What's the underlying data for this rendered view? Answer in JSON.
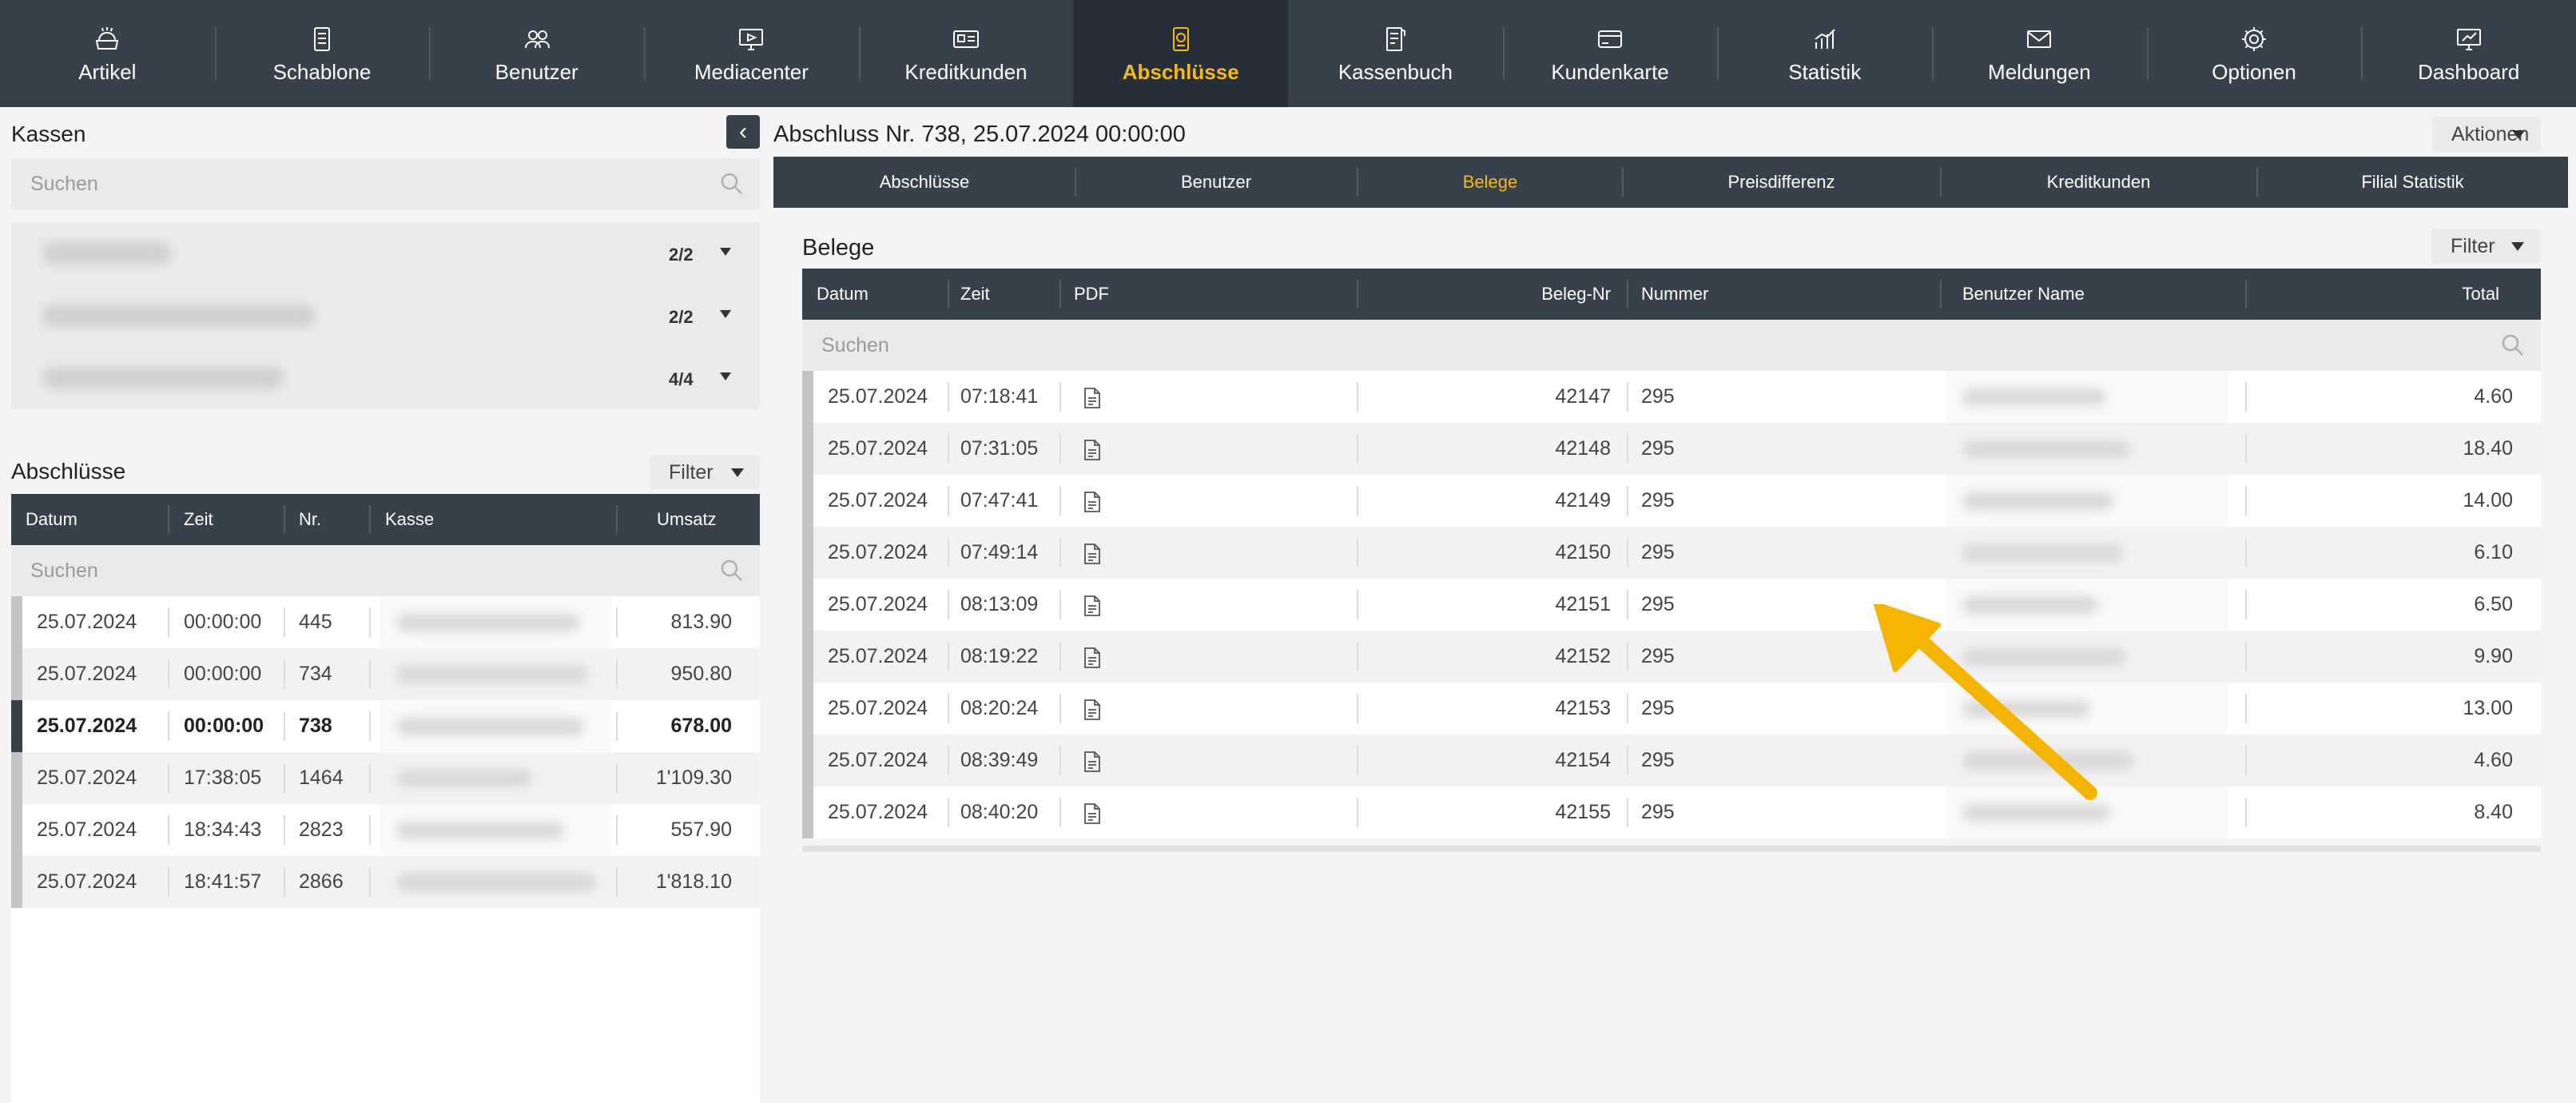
{
  "nav": [
    {
      "label": "Artikel",
      "icon": "basket-icon"
    },
    {
      "label": "Schablone",
      "icon": "template-icon"
    },
    {
      "label": "Benutzer",
      "icon": "users-icon"
    },
    {
      "label": "Mediacenter",
      "icon": "monitor-icon"
    },
    {
      "label": "Kreditkunden",
      "icon": "id-card-icon"
    },
    {
      "label": "Abschlüsse",
      "icon": "closing-icon",
      "active": true
    },
    {
      "label": "Kassenbuch",
      "icon": "ledger-icon"
    },
    {
      "label": "Kundenkarte",
      "icon": "card-icon"
    },
    {
      "label": "Statistik",
      "icon": "chart-icon"
    },
    {
      "label": "Meldungen",
      "icon": "mail-icon"
    },
    {
      "label": "Optionen",
      "icon": "gear-icon"
    },
    {
      "label": "Dashboard",
      "icon": "dashboard-icon"
    }
  ],
  "kassen": {
    "title": "Kassen",
    "search_placeholder": "Suchen",
    "items": [
      {
        "count": "2/2"
      },
      {
        "count": "2/2"
      },
      {
        "count": "4/4"
      }
    ]
  },
  "abschluesse": {
    "title": "Abschlüsse",
    "filter_label": "Filter",
    "search_placeholder": "Suchen",
    "columns": [
      "Datum",
      "Zeit",
      "Nr.",
      "Kasse",
      "Umsatz"
    ],
    "rows": [
      {
        "datum": "25.07.2024",
        "zeit": "00:00:00",
        "nr": "445",
        "umsatz": "813.90"
      },
      {
        "datum": "25.07.2024",
        "zeit": "00:00:00",
        "nr": "734",
        "umsatz": "950.80"
      },
      {
        "datum": "25.07.2024",
        "zeit": "00:00:00",
        "nr": "738",
        "umsatz": "678.00",
        "selected": true
      },
      {
        "datum": "25.07.2024",
        "zeit": "17:38:05",
        "nr": "1464",
        "umsatz": "1'109.30"
      },
      {
        "datum": "25.07.2024",
        "zeit": "18:34:43",
        "nr": "2823",
        "umsatz": "557.90"
      },
      {
        "datum": "25.07.2024",
        "zeit": "18:41:57",
        "nr": "2866",
        "umsatz": "1'818.10"
      }
    ]
  },
  "detail": {
    "title": "Abschluss Nr. 738, 25.07.2024 00:00:00",
    "actions_label": "Aktionen",
    "tabs": [
      "Abschlüsse",
      "Benutzer",
      "Belege",
      "Preisdifferenz",
      "Kreditkunden",
      "Filial Statistik"
    ],
    "active_tab": "Belege"
  },
  "belege": {
    "title": "Belege",
    "filter_label": "Filter",
    "search_placeholder": "Suchen",
    "columns": [
      "Datum",
      "Zeit",
      "PDF",
      "Beleg-Nr",
      "Nummer",
      "Benutzer Name",
      "Total"
    ],
    "rows": [
      {
        "datum": "25.07.2024",
        "zeit": "07:18:41",
        "beleg_nr": "42147",
        "nummer": "295",
        "total": "4.60"
      },
      {
        "datum": "25.07.2024",
        "zeit": "07:31:05",
        "beleg_nr": "42148",
        "nummer": "295",
        "total": "18.40"
      },
      {
        "datum": "25.07.2024",
        "zeit": "07:47:41",
        "beleg_nr": "42149",
        "nummer": "295",
        "total": "14.00"
      },
      {
        "datum": "25.07.2024",
        "zeit": "07:49:14",
        "beleg_nr": "42150",
        "nummer": "295",
        "total": "6.10"
      },
      {
        "datum": "25.07.2024",
        "zeit": "08:13:09",
        "beleg_nr": "42151",
        "nummer": "295",
        "total": "6.50"
      },
      {
        "datum": "25.07.2024",
        "zeit": "08:19:22",
        "beleg_nr": "42152",
        "nummer": "295",
        "total": "9.90"
      },
      {
        "datum": "25.07.2024",
        "zeit": "08:20:24",
        "beleg_nr": "42153",
        "nummer": "295",
        "total": "13.00"
      },
      {
        "datum": "25.07.2024",
        "zeit": "08:39:49",
        "beleg_nr": "42154",
        "nummer": "295",
        "total": "4.60"
      },
      {
        "datum": "25.07.2024",
        "zeit": "08:40:20",
        "beleg_nr": "42155",
        "nummer": "295",
        "total": "8.40"
      }
    ]
  },
  "colors": {
    "nav_bg": "#36414b",
    "nav_active_bg": "#262f38",
    "accent": "#f5b919",
    "annotation_arrow": "#f5b400"
  },
  "annotation": {
    "type": "arrow",
    "points_to": "pdf-icon row 42149"
  }
}
